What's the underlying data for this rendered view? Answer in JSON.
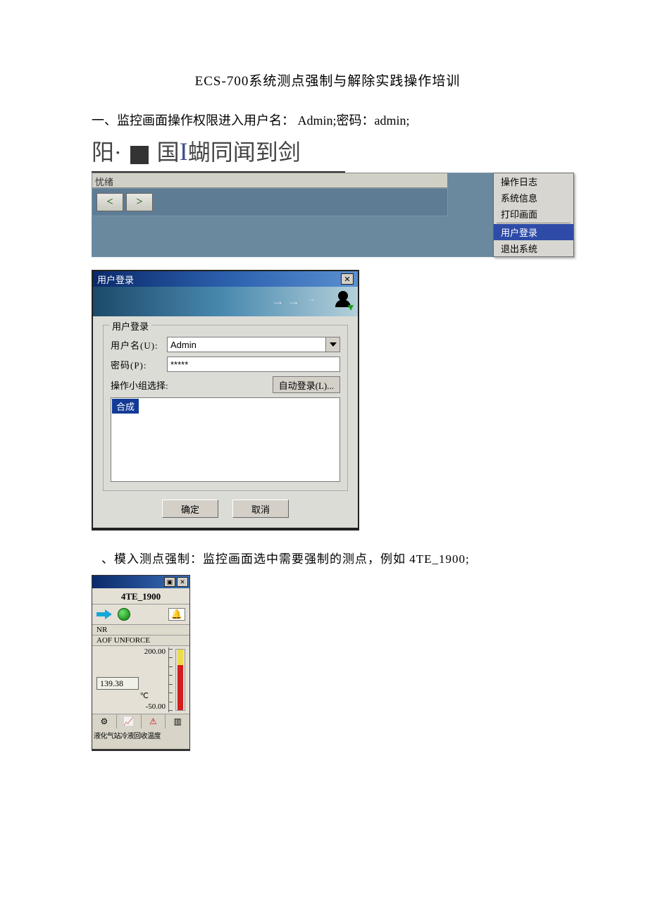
{
  "doc_title": "ECS-700系统测点强制与解除实践操作培训",
  "section_one": "一、监控画面操作权限进入用户名： Admin;密码：admin;",
  "decor": {
    "a": "阳·",
    "b": "国",
    "c": "蝴同闻到剑"
  },
  "menubar": {
    "status": "忧绪",
    "prev": "<",
    "next": ">",
    "menu": {
      "items": [
        {
          "label": "操作日志",
          "tag": "op-log"
        },
        {
          "label": "系统信息",
          "tag": "sys-info"
        },
        {
          "label": "打印画面",
          "tag": "print-view"
        },
        {
          "label": "用户登录",
          "tag": "user-login",
          "selected": true
        },
        {
          "label": "退出系统",
          "tag": "exit-system"
        }
      ]
    }
  },
  "login": {
    "title": "用户登录",
    "group_legend": "用户登录",
    "user_label": "用户名(U):",
    "user_value": "Admin",
    "pass_label": "密码(P):",
    "pass_value": "*****",
    "ops_label": "操作小组选择:",
    "auto_login": "自动登录(L)...",
    "list_item": "合成",
    "ok": "确定",
    "cancel": "取消"
  },
  "section_two": "、模入测点强制：监控画面选中需要强制的测点，例如 4TE_1900;",
  "tag": {
    "name": "4TE_1900",
    "nr": "NR",
    "aof": "AOF UNFORCE",
    "max": "200.00",
    "value": "139.38",
    "unit": "℃",
    "min": "-50.00",
    "desc": "液化气站冷液回收温度"
  }
}
